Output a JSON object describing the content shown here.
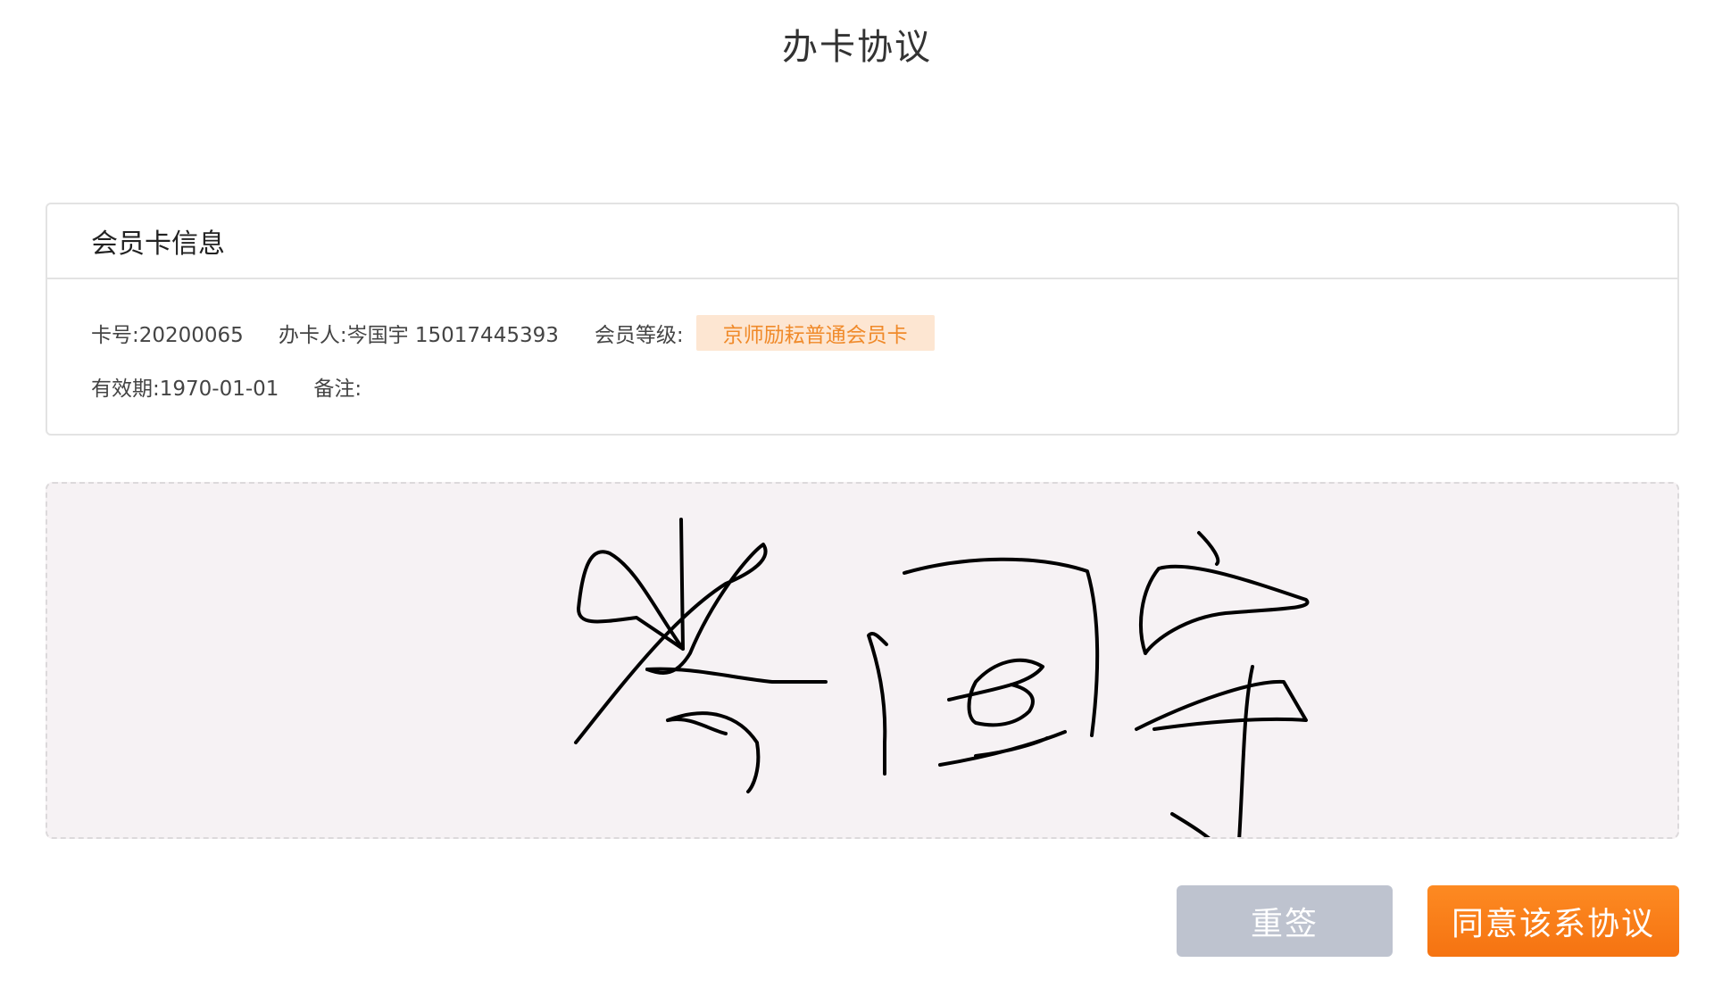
{
  "header": {
    "title": "办卡协议"
  },
  "card_info": {
    "section_title": "会员卡信息",
    "card_no": "卡号:20200065",
    "holder": "办卡人:岑国宇 15017445393",
    "level_label": "会员等级:",
    "level_value": "京师励耘普通会员卡",
    "valid_until": "有效期:1970-01-01",
    "remark": "备注:"
  },
  "signature": {
    "handwritten_text": "岑国宇",
    "ink_color": "#000000"
  },
  "actions": {
    "resign_label": "重签",
    "agree_label": "同意该系协议"
  },
  "colors": {
    "accent": "#f57311",
    "badge_bg": "#fde6d2",
    "badge_text": "#f08a2a",
    "disabled_button": "#bec3cf",
    "pad_bg": "#f6f2f4"
  }
}
